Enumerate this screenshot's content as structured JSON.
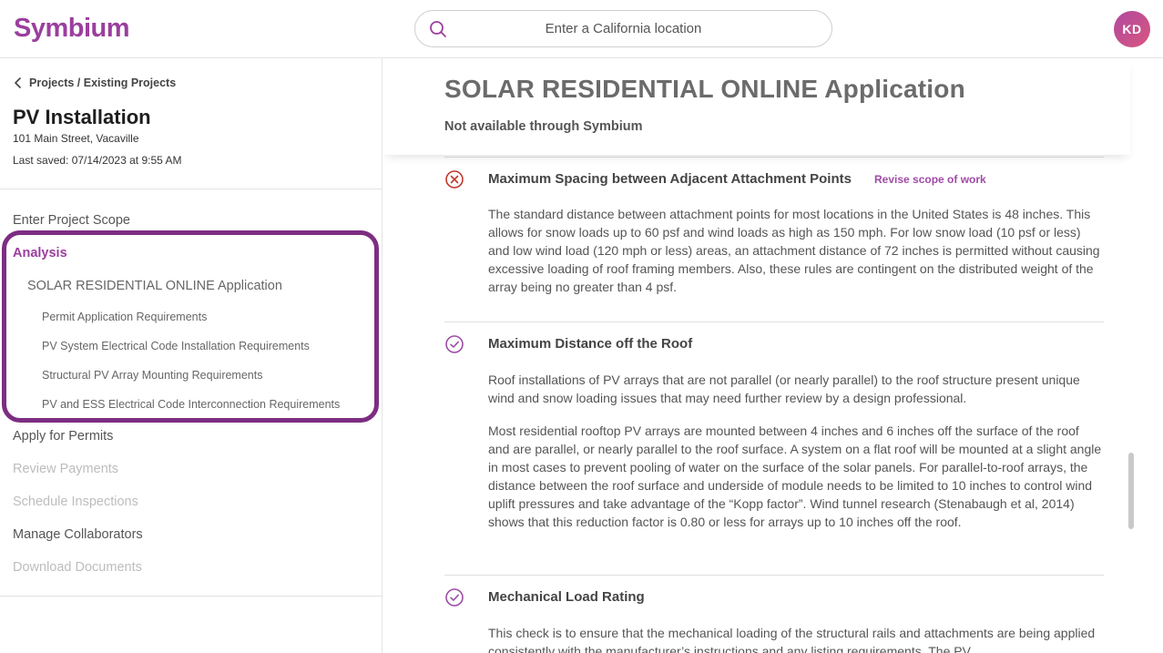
{
  "header": {
    "logo": "Symbium",
    "search": {
      "placeholder": "Enter a California location",
      "icon": "search-icon"
    },
    "avatar_initials": "KD"
  },
  "sidebar": {
    "breadcrumb": "Projects / Existing Projects",
    "project_title": "PV Installation",
    "project_address": "101 Main Street, Vacaville",
    "last_saved": "Last saved: 07/14/2023 at 9:55 AM",
    "nav": {
      "enter_scope": "Enter Project Scope",
      "analysis": "Analysis",
      "application": "SOLAR RESIDENTIAL ONLINE Application",
      "sub_items": [
        "Permit Application Requirements",
        "PV System Electrical Code Installation Requirements",
        "Structural PV Array Mounting Requirements",
        "PV and ESS Electrical Code Interconnection Requirements"
      ],
      "apply_permits": "Apply for Permits",
      "review_payments": "Review Payments",
      "schedule_inspections": "Schedule Inspections",
      "manage_collaborators": "Manage Collaborators",
      "download_documents": "Download Documents"
    }
  },
  "main": {
    "title": "SOLAR RESIDENTIAL ONLINE Application",
    "availability": "Not available through Symbium",
    "checks": [
      {
        "status": "fail",
        "title": "Maximum Spacing between Adjacent Attachment Points",
        "action": "Revise scope of work",
        "paragraphs": [
          "The standard distance between attachment points for most locations in the United States is 48 inches. This allows for snow loads up to 60 psf and wind loads as high as 150 mph. For low snow load (10 psf or less) and low wind load (120 mph or less) areas, an attachment distance of 72 inches is permitted without causing excessive loading of roof framing members. Also, these rules are contingent on the distributed weight of the array being no greater than 4 psf."
        ]
      },
      {
        "status": "pass",
        "title": "Maximum Distance off the Roof",
        "paragraphs": [
          "Roof installations of PV arrays that are not parallel (or nearly parallel) to the roof structure present unique wind and snow loading issues that may need further review by a design professional.",
          "Most residential rooftop PV arrays are mounted between 4 inches and 6 inches off the surface of the roof and are parallel, or nearly parallel to the roof surface. A system on a flat roof will be mounted at a slight angle in most cases to prevent pooling of water on the surface of the solar panels. For parallel-to-roof arrays, the distance between the roof surface and underside of module needs to be limited to 10 inches to control wind uplift pressures and take advantage of the “Kopp factor”. Wind tunnel research (Stenabaugh et al, 2014) shows that this reduction factor is 0.80 or less for arrays up to 10 inches off the roof."
        ]
      },
      {
        "status": "pass",
        "title": "Mechanical Load Rating",
        "paragraphs": [
          "This check is to ensure that the mechanical loading of the structural rails and attachments are being applied consistently with the manufacturer’s instructions and any listing requirements. The PV"
        ]
      }
    ]
  },
  "colors": {
    "brand": "#9b3d9e",
    "highlight": "#7d2d82",
    "fail": "#c0392b",
    "pass": "#9b4ea4"
  }
}
